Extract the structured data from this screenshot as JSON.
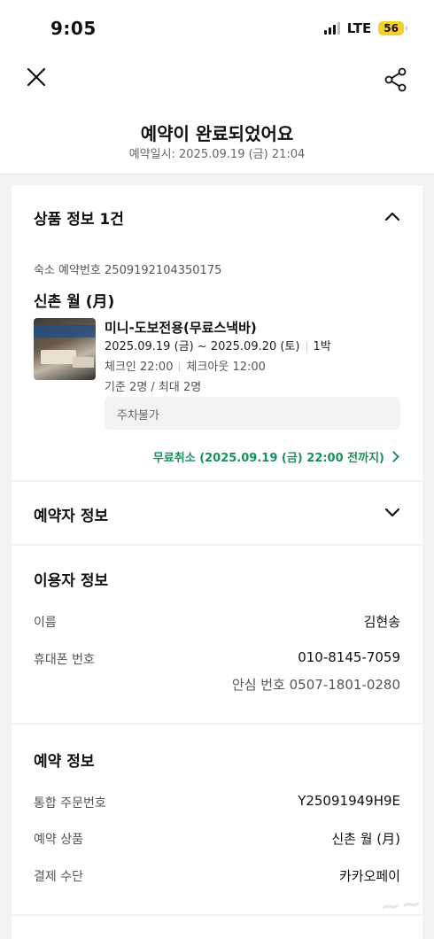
{
  "status_bar": {
    "time": "9:05",
    "network": "LTE",
    "battery": "56"
  },
  "header": {
    "title": "예약이 완료되었어요",
    "subtitle": "예약일시: 2025.09.19 (금) 21:04"
  },
  "product_info": {
    "section_title": "상품 정보 1건",
    "reservation_number": "숙소 예약번호 2509192104350175",
    "lodging_name": "신촌 월 (月)",
    "room_name": "미니-도보전용(무료스낵바)",
    "dates": "2025.09.19 (금) ~ 2025.09.20 (토)",
    "nights": "1박",
    "checkin": "체크인 22:00",
    "checkout": "체크아웃 12:00",
    "capacity": "기준 2명 / 최대 2명",
    "parking": "주차불가",
    "cancel_policy": "무료취소 (2025.09.19 (금) 22:00 전까지)"
  },
  "booker_info": {
    "section_title": "예약자 정보"
  },
  "user_info": {
    "section_title": "이용자 정보",
    "name_label": "이름",
    "name_value": "김현송",
    "phone_label": "휴대폰 번호",
    "phone_value": "010-8145-7059",
    "safe_number": "안심 번호 0507-1801-0280"
  },
  "reservation_info": {
    "section_title": "예약 정보",
    "order_label": "통합 주문번호",
    "order_value": "Y25091949H9E",
    "product_label": "예약 상품",
    "product_value": "신촌 월 (月)",
    "payment_label": "결제 수단",
    "payment_value": "카카오페이"
  },
  "colors": {
    "accent_green": "#19915c",
    "background": "#f2f2f2",
    "battery": "#f5d02a"
  }
}
